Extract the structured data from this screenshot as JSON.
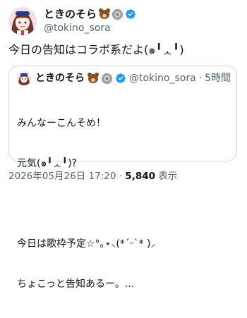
{
  "post": {
    "author": {
      "display_name": "ときのそら",
      "handle": "@tokino_sora"
    },
    "text": "今日の告知はコラボ系だよ(๑╹ᆺ╹)",
    "quote": {
      "display_name": "ときのそら",
      "handle": "@tokino_sora",
      "separator": "·",
      "time": "5時間",
      "lines": [
        "みんなーこんそめ！",
        "元気(๑╹ᆺ╹)?",
        "",
        "今日は歌枠予定☆°｡⋆⸜(*ˊᵕˋ* )⸝",
        "ちょこっと告知あるー。..."
      ]
    },
    "footer": {
      "timestamp": "2026年05月26日 17:20",
      "separator": " · ",
      "views": "5,840",
      "views_label": " 表示"
    }
  },
  "icons": [
    "bear-emoji-icon",
    "disc-emoji-icon",
    "verified-badge-icon"
  ],
  "colors": {
    "text_primary": "#0f1419",
    "text_secondary": "#536471",
    "border": "#cfd9de",
    "verified": "#1d9bf0"
  }
}
